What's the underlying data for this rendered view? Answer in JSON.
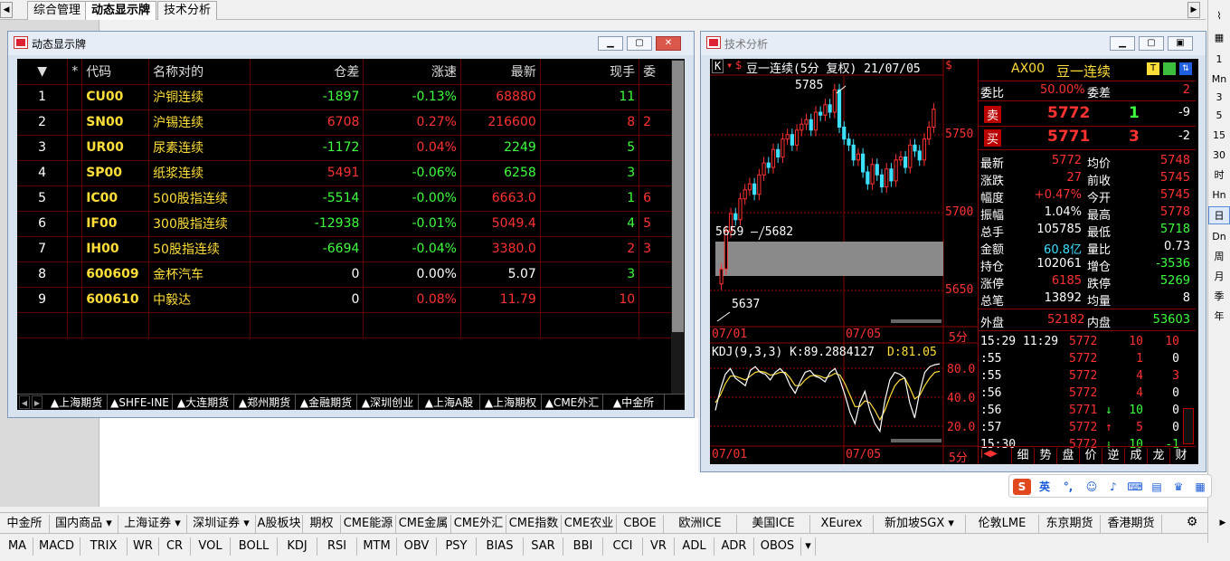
{
  "app_tabs": [
    "综合管理",
    "动态显示牌",
    "技术分析"
  ],
  "right_toolbar": [
    "1",
    "Mn",
    "3",
    "5",
    "15",
    "30",
    "时",
    "Hn",
    "日",
    "Dn",
    "周",
    "月",
    "季",
    "年"
  ],
  "board": {
    "title": "动态显示牌",
    "headers": [
      "▼",
      "*",
      "代码",
      "名称对的",
      "仓差",
      "涨速",
      "最新",
      "现手",
      "委"
    ],
    "rows": [
      {
        "no": "1",
        "code": "CU00",
        "name": "沪铜连续",
        "cang": "-1897",
        "speed": "-0.13%",
        "last": "68880",
        "hand": "11",
        "extra": "",
        "cang_c": "grn",
        "speed_c": "grn",
        "last_c": "red",
        "hand_c": "grn"
      },
      {
        "no": "2",
        "code": "SN00",
        "name": "沪锡连续",
        "cang": "6708",
        "speed": "0.27%",
        "last": "216600",
        "hand": "8",
        "extra": "2",
        "cang_c": "red",
        "speed_c": "red",
        "last_c": "red",
        "hand_c": "red"
      },
      {
        "no": "3",
        "code": "UR00",
        "name": "尿素连续",
        "cang": "-1172",
        "speed": "0.04%",
        "last": "2249",
        "hand": "5",
        "extra": "",
        "cang_c": "grn",
        "speed_c": "red",
        "last_c": "grn",
        "hand_c": "grn"
      },
      {
        "no": "4",
        "code": "SP00",
        "name": "纸浆连续",
        "cang": "5491",
        "speed": "-0.06%",
        "last": "6258",
        "hand": "3",
        "extra": "",
        "cang_c": "red",
        "speed_c": "grn",
        "last_c": "grn",
        "hand_c": "grn"
      },
      {
        "no": "5",
        "code": "IC00",
        "name": "500股指连续",
        "cang": "-5514",
        "speed": "-0.00%",
        "last": "6663.0",
        "hand": "1",
        "extra": "6",
        "cang_c": "grn",
        "speed_c": "grn",
        "last_c": "red",
        "hand_c": "grn"
      },
      {
        "no": "6",
        "code": "IF00",
        "name": "300股指连续",
        "cang": "-12938",
        "speed": "-0.01%",
        "last": "5049.4",
        "hand": "4",
        "extra": "5",
        "cang_c": "grn",
        "speed_c": "grn",
        "last_c": "red",
        "hand_c": "grn"
      },
      {
        "no": "7",
        "code": "IH00",
        "name": "50股指连续",
        "cang": "-6694",
        "speed": "-0.04%",
        "last": "3380.0",
        "hand": "2",
        "extra": "3",
        "cang_c": "grn",
        "speed_c": "grn",
        "last_c": "red",
        "hand_c": "red"
      },
      {
        "no": "8",
        "code": "600609",
        "name": "金杯汽车",
        "cang": "0",
        "speed": "0.00%",
        "last": "5.07",
        "hand": "3",
        "extra": "",
        "cang_c": "wht",
        "speed_c": "wht",
        "last_c": "wht",
        "hand_c": "grn"
      },
      {
        "no": "9",
        "code": "600610",
        "name": "中毅达",
        "cang": "0",
        "speed": "0.08%",
        "last": "11.79",
        "hand": "10",
        "extra": "",
        "cang_c": "wht",
        "speed_c": "red",
        "last_c": "red",
        "hand_c": "red"
      }
    ],
    "sheet_tabs": [
      "▲上海期货",
      "▲SHFE-INE",
      "▲大连期货",
      "▲郑州期货",
      "▲金融期货",
      "▲深圳创业",
      "▲上海A股",
      "▲上海期权",
      "▲CME外汇",
      "▲中金所"
    ]
  },
  "tech": {
    "title": "技术分析",
    "kline_title": "豆一连续(5分 复权) 21/07/05",
    "price_labels": [
      "5750",
      "5700",
      "5650"
    ],
    "high_label": "5785",
    "range_label": "5659 — 5682",
    "low_label": "5637",
    "date_labels": [
      "07/01",
      "07/05"
    ],
    "period_label": "5分",
    "kdj_label": "KDJ(9,3,3) K:89.2884127",
    "kdj_d": "D:81.05",
    "kdj_levels": [
      "80.0",
      "40.0",
      "20.0"
    ],
    "kdj_dates": [
      "07/01",
      "07/05"
    ],
    "kdj_period": "5分",
    "chart_data": {
      "type": "candlestick",
      "ylim": [
        5630,
        5790
      ],
      "close": [
        5665,
        5690,
        5702,
        5698,
        5712,
        5718,
        5722,
        5715,
        5728,
        5736,
        5733,
        5745,
        5740,
        5752,
        5755,
        5748,
        5758,
        5762,
        5765,
        5758,
        5770,
        5768,
        5775,
        5770,
        5785,
        5760,
        5752,
        5748,
        5738,
        5742,
        5730,
        5722,
        5735,
        5728,
        5720,
        5732,
        5724,
        5738,
        5740,
        5733,
        5748,
        5744,
        5738,
        5752,
        5760,
        5772
      ],
      "kdj_k": [
        40,
        62,
        78,
        84,
        74,
        70,
        66,
        82,
        86,
        80,
        78,
        72,
        80,
        84,
        78,
        66,
        58,
        70,
        80,
        82,
        76,
        74,
        70,
        80,
        84,
        72,
        56,
        38,
        26,
        48,
        60,
        40,
        26,
        18,
        50,
        72,
        80,
        78,
        74,
        48,
        32,
        60,
        80,
        86,
        88,
        89
      ],
      "kdj_d": [
        48,
        56,
        68,
        76,
        76,
        74,
        72,
        76,
        80,
        81,
        80,
        77,
        78,
        80,
        80,
        74,
        66,
        66,
        72,
        76,
        77,
        76,
        74,
        76,
        79,
        77,
        68,
        56,
        44,
        44,
        50,
        48,
        40,
        30,
        40,
        54,
        66,
        72,
        74,
        64,
        52,
        56,
        66,
        74,
        80,
        81
      ]
    },
    "symbol": "AX00",
    "symbol_name": "豆一连续",
    "wei_label": "委比",
    "wei_val": "50.00%",
    "weicha_label": "委差",
    "weicha_val": "2",
    "sell_label": "卖",
    "sell_price": "5772",
    "sell_vol": "1",
    "sell_chg": "-9",
    "buy_label": "买",
    "buy_price": "5771",
    "buy_vol": "3",
    "buy_chg": "-2",
    "stats": [
      [
        "最新",
        "5772",
        "均价",
        "5748"
      ],
      [
        "涨跌",
        "27",
        "前收",
        "5745"
      ],
      [
        "幅度",
        "+0.47%",
        "今开",
        "5745"
      ],
      [
        "振幅",
        "1.04%",
        "最高",
        "5778"
      ],
      [
        "总手",
        "105785",
        "最低",
        "5718"
      ],
      [
        "金额",
        "60.8亿",
        "量比",
        "0.73"
      ],
      [
        "持仓",
        "102061",
        "增仓",
        "-3536"
      ],
      [
        "涨停",
        "6185",
        "跌停",
        "5269"
      ],
      [
        "总笔",
        "13892",
        "均量",
        "8"
      ]
    ],
    "outer_label": "外盘",
    "outer_val": "52182",
    "inner_label": "内盘",
    "inner_val": "53603",
    "ticks": [
      {
        "t": "15:29 11:29",
        "p": "5772",
        "a": "",
        "v": "10",
        "o": "10",
        "pc": "red",
        "vc": "red",
        "oc": "red"
      },
      {
        "t": ":55",
        "p": "5772",
        "a": "",
        "v": "1",
        "o": "0",
        "pc": "red",
        "vc": "red",
        "oc": "wht"
      },
      {
        "t": ":55",
        "p": "5772",
        "a": "",
        "v": "4",
        "o": "3",
        "pc": "red",
        "vc": "red",
        "oc": "red"
      },
      {
        "t": ":56",
        "p": "5772",
        "a": "",
        "v": "4",
        "o": "0",
        "pc": "red",
        "vc": "red",
        "oc": "wht"
      },
      {
        "t": ":56",
        "p": "5771",
        "a": "↓",
        "v": "10",
        "o": "0",
        "pc": "red",
        "vc": "grn",
        "oc": "wht"
      },
      {
        "t": ":57",
        "p": "5772",
        "a": "↑",
        "v": "5",
        "o": "0",
        "pc": "red",
        "vc": "red",
        "oc": "wht"
      },
      {
        "t": "15:30",
        "p": "5772",
        "a": "↓",
        "v": "10",
        "o": "-1",
        "pc": "red",
        "vc": "grn",
        "oc": "grn"
      }
    ],
    "panel_tabs": [
      "细",
      "势",
      "盘",
      "价",
      "逆",
      "成",
      "龙",
      "财"
    ]
  },
  "bottom_bar1": [
    "中金所",
    "国内商品 ▾",
    "上海证券 ▾",
    "深圳证券 ▾",
    "A股板块",
    "期权",
    "CME能源",
    "CME金属",
    "CME外汇",
    "CME指数",
    "CME农业",
    "CBOE",
    "欧洲ICE",
    "美国ICE",
    "XEurex",
    "新加坡SGX ▾",
    "伦敦LME",
    "东京期货",
    "香港期货"
  ],
  "bottom_bar2": [
    "MA",
    "MACD",
    "TRIX",
    "WR",
    "CR",
    "VOL",
    "BOLL",
    "KDJ",
    "RSI",
    "MTM",
    "OBV",
    "PSY",
    "BIAS",
    "SAR",
    "BBI",
    "CCI",
    "VR",
    "ADL",
    "ADR",
    "OBOS"
  ],
  "ime": {
    "logo": "S",
    "lang": "英"
  }
}
